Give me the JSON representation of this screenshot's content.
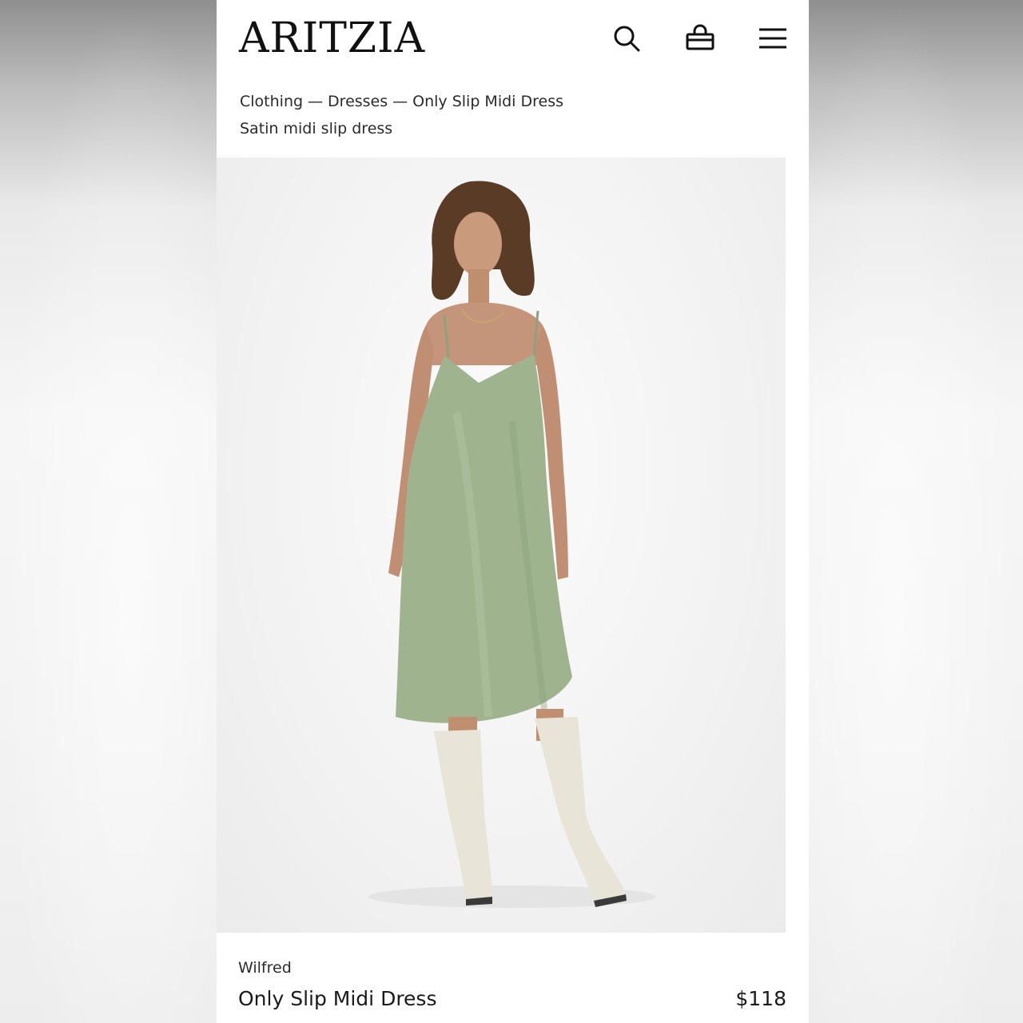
{
  "header": {
    "logo_text": "ARITZIA",
    "icons": [
      "search-icon",
      "shopping-bag-icon",
      "menu-icon"
    ]
  },
  "breadcrumb": {
    "items": [
      "Clothing",
      "Dresses",
      "Only Slip Midi Dress"
    ],
    "separator": "—"
  },
  "product": {
    "subtitle": "Satin midi slip dress",
    "brand": "Wilfred",
    "name": "Only Slip Midi Dress",
    "price": "$118",
    "dress_color": "#9fb38f"
  }
}
